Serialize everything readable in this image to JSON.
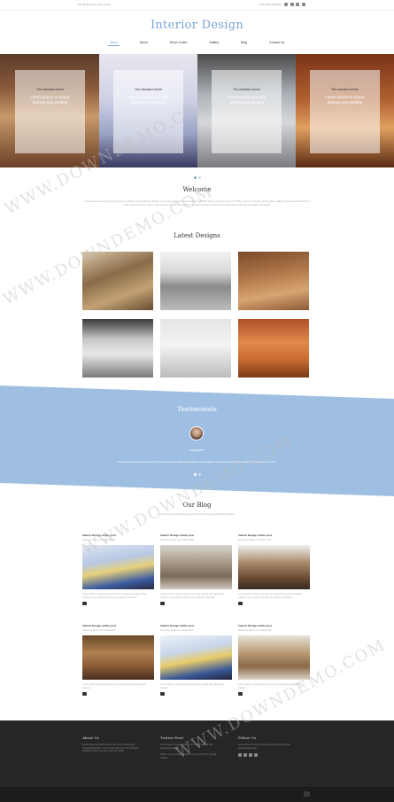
{
  "topbar": {
    "contact_left": "ZR, Beijing and more zones",
    "contact_right": "+123 456 789 0123"
  },
  "logo": "Interior Design",
  "nav": [
    "Home",
    "About",
    "Short Codes",
    "Gallery",
    "Blog",
    "Contact Us"
  ],
  "slider": {
    "slides": [
      {
        "title": "The standard chunk",
        "text": "Lorem Ipsum is simply dummy text printing"
      },
      {
        "title": "The standard chunk",
        "text": "Lorem Ipsum is simply dummy text printing"
      },
      {
        "title": "The standard chunk",
        "text": "Lorem Ipsum is simply dummy text printing"
      },
      {
        "title": "The standard chunk",
        "text": "Lorem Ipsum is simply dummy text printing"
      }
    ]
  },
  "welcome": {
    "title": "Welcome",
    "text": "Lorem Ipsum is simply dummy text of the printing and typesetting industry. Lorem Ipsum has been the industry's standard dummy text ever since the 1500s, when an unknown printer took a galley of type and scrambled it to make a type specimen book. It has survived not only five centuries, but also the leap into electronic typesetting, remaining essentially unchanged."
  },
  "designs": {
    "title": "Latest Designs"
  },
  "testimonials": {
    "title": "Testimonials",
    "name": "Lucy grehm",
    "quote": "Lorem Ipsum is simply dummy text of the printing and typesetting industry. Lorem Ipsum has been the industry's standard dummy text ever since."
  },
  "blog": {
    "title": "Our Blog",
    "subtitle": "Lorem Ipsum is simply dummy text of the printing and typesetting industry.",
    "posts": [
      {
        "title": "Interior Design article post",
        "meta": "Posted by admin on 12 May 2015",
        "excerpt": "Lorem Ipsum is simply dummy text of the printing and typesetting industry. Lorem Ipsum has been the industry's standard."
      },
      {
        "title": "Interior Design article post",
        "meta": "Posted by admin on 12 May 2015",
        "excerpt": "Lorem Ipsum is simply dummy text of the printing and typesetting industry. Lorem Ipsum has been the industry's standard."
      },
      {
        "title": "Interior Design article post",
        "meta": "Posted by admin on 12 May 2015",
        "excerpt": "Lorem Ipsum is simply dummy text of the printing and typesetting industry. Lorem Ipsum has been the industry's standard."
      },
      {
        "title": "Interior Design article post",
        "meta": "Posted by admin on 12 May 2015",
        "excerpt": "Lorem Ipsum is simply dummy text of the printing and typesetting industry."
      },
      {
        "title": "Interior Design article post",
        "meta": "Posted by admin on 12 May 2015",
        "excerpt": "Lorem Ipsum is simply dummy text of the printing and typesetting industry."
      },
      {
        "title": "Interior Design article post",
        "meta": "Posted by admin on 12 May 2015",
        "excerpt": "Lorem Ipsum is simply dummy text of the printing and typesetting industry."
      }
    ]
  },
  "footer": {
    "about": {
      "title": "About Us",
      "text": "Lorem Ipsum is simply dummy text of the printing and typesetting industry. Lorem Ipsum has been the industry's standard dummy text ever since the 1500s."
    },
    "twitter": {
      "title": "Twitter Feed",
      "tweet1": "Lorem Ipsum is simply dummy text of the printing and typesetting industry.",
      "tweet2": "Twitter: Lorem Ipsum is simply dummy text of the printing industry."
    },
    "follow": {
      "title": "Follow Us",
      "text": "Lorem Ipsum is simply dummy text of the printing and typesetting industry."
    }
  },
  "watermark": "WWW.DOWNDEMO.COM",
  "colors": {
    "accent": "#7aa5d6",
    "band": "#9fbfe2",
    "footer": "#262626"
  }
}
